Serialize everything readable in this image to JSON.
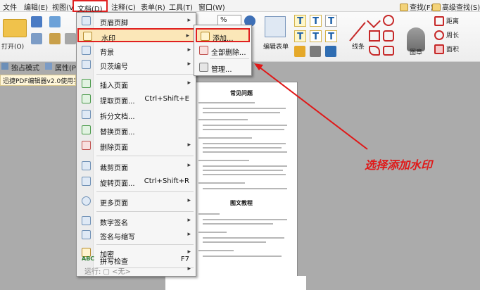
{
  "menubar": {
    "items": [
      "文件",
      "编辑(E)",
      "视图(V)",
      "文档(D)",
      "注释(C)",
      "表单(R)",
      "工具(T)",
      "窗口(W)"
    ],
    "search": "查找(F)",
    "advanced_search": "高级查找(S)"
  },
  "ribbon": {
    "open": "打开(O)",
    "zoom_value": "%",
    "edit_form": "编辑表单",
    "lines": "线条",
    "shapes": "图章",
    "distance": "距离",
    "perimeter": "周长",
    "area": "面积"
  },
  "subbar": {
    "mode": "独占模式",
    "properties": "属性(P)..."
  },
  "doc_tab": "迅捷PDF编辑器v2.0使用手册",
  "document": {
    "title1": "常见问题",
    "title2": "图文教程"
  },
  "annotation": "选择添加水印",
  "menu": {
    "items": [
      {
        "label": "页眉页脚",
        "shortcut": "",
        "submenu": true
      },
      {
        "label": "水印",
        "shortcut": "",
        "submenu": true
      },
      {
        "label": "背景",
        "shortcut": "",
        "submenu": true
      },
      {
        "label": "贝茨编号",
        "shortcut": "",
        "submenu": true
      },
      {
        "label": "插入页面",
        "shortcut": "",
        "submenu": true
      },
      {
        "label": "提取页面...",
        "shortcut": "Ctrl+Shift+E",
        "submenu": false
      },
      {
        "label": "拆分文档...",
        "shortcut": "",
        "submenu": false
      },
      {
        "label": "替换页面...",
        "shortcut": "",
        "submenu": false
      },
      {
        "label": "删除页面",
        "shortcut": "",
        "submenu": true
      },
      {
        "label": "裁剪页面",
        "shortcut": "",
        "submenu": true
      },
      {
        "label": "旋转页面...",
        "shortcut": "Ctrl+Shift+R",
        "submenu": false
      },
      {
        "label": "更多页面",
        "shortcut": "",
        "submenu": true
      },
      {
        "label": "数字签名",
        "shortcut": "",
        "submenu": true
      },
      {
        "label": "签名与缩写",
        "shortcut": "",
        "submenu": true
      },
      {
        "label": "加密",
        "shortcut": "",
        "submenu": true
      },
      {
        "label": "拼写检查",
        "shortcut": "F7",
        "submenu": false
      },
      {
        "label": "运行: ▢ <无>",
        "shortcut": "",
        "submenu": true
      }
    ]
  },
  "submenu": {
    "items": [
      "添加...",
      "全部删除...",
      "管理..."
    ]
  },
  "colors": {
    "highlight_border": "#e02020",
    "annotation": "#e01818",
    "highlight_fill": "#fbe7b8"
  }
}
